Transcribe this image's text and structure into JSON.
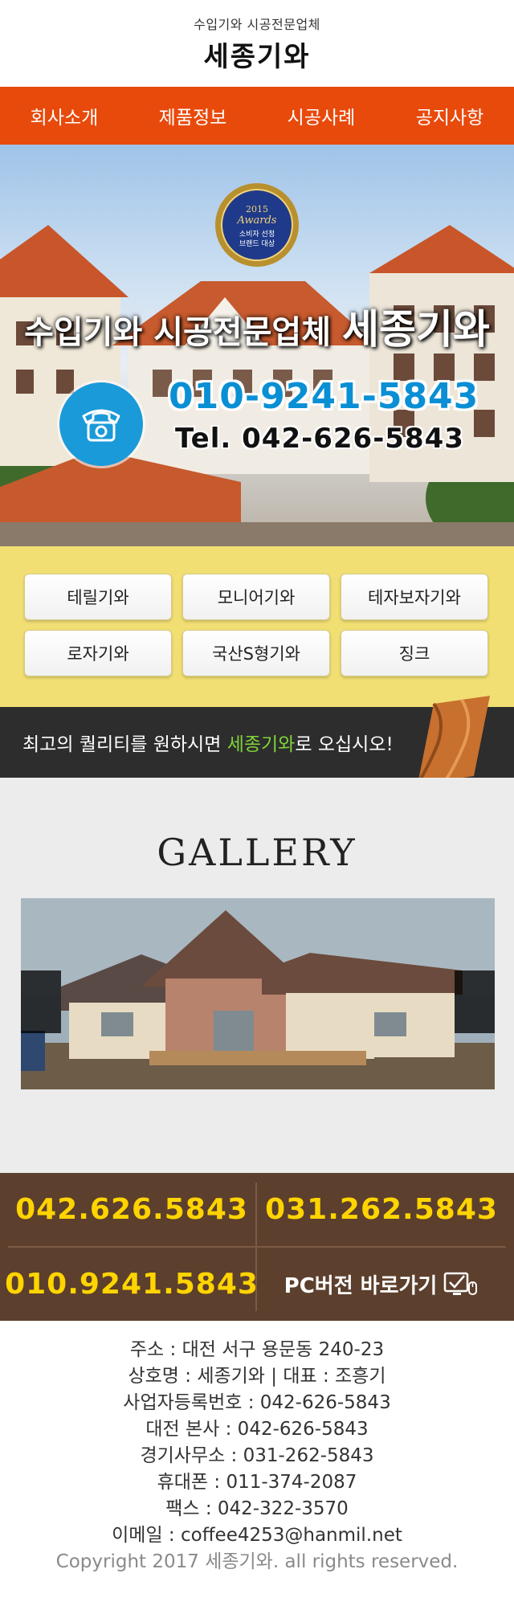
{
  "header": {
    "subtitle": "수입기와 시공전문업체",
    "brand": "세종기와"
  },
  "nav": {
    "items": [
      {
        "label": "회사소개"
      },
      {
        "label": "제품정보"
      },
      {
        "label": "시공사례"
      },
      {
        "label": "공지사항"
      }
    ]
  },
  "hero": {
    "badge_year": "2015",
    "badge_award": "Awards",
    "badge_line1": "소비자 선정",
    "badge_line2": "브랜드 대상",
    "title_prefix": "수입기와 시공전문업체",
    "title_brand": "세종기와",
    "mobile": "010-9241-5843",
    "tel": "Tel. 042-626-5843",
    "icon": "telephone-icon"
  },
  "products": {
    "items": [
      {
        "label": "테릴기와"
      },
      {
        "label": "모니어기와"
      },
      {
        "label": "테자보자기와"
      },
      {
        "label": "로자기와"
      },
      {
        "label": "국산S형기와"
      },
      {
        "label": "징크"
      }
    ]
  },
  "quality": {
    "text_before": "최고의 퀄리티를 원하시면 ",
    "brand": "세종기와",
    "text_after": "로 오십시오!"
  },
  "gallery": {
    "title": "GALLERY"
  },
  "contact": {
    "phone1": "042.626.5843",
    "phone2": "031.262.5843",
    "phone3": "010.9241.5843",
    "pc_label": "PC버전 바로가기",
    "accent": "#ffd400",
    "background": "#5c3f2d"
  },
  "footer": {
    "lines": [
      "주소 : 대전 서구 용문동 240-23",
      "상호명 : 세종기와 | 대표 : 조흥기",
      "사업자등록번호 : 042-626-5843",
      "대전 본사 : 042-626-5843",
      "경기사무소 : 031-262-5843",
      "휴대폰 : 011-374-2087",
      "팩스 : 042-322-3570",
      "이메일 : coffee4253@hanmil.net"
    ],
    "copyright": "Copyright 2017 세종기와.  all rights reserved."
  },
  "colors": {
    "nav": "#e84a0c",
    "products_bg": "#f1df73",
    "mobile_blue": "#0a8fd4",
    "brand_green": "#7fd33a"
  }
}
